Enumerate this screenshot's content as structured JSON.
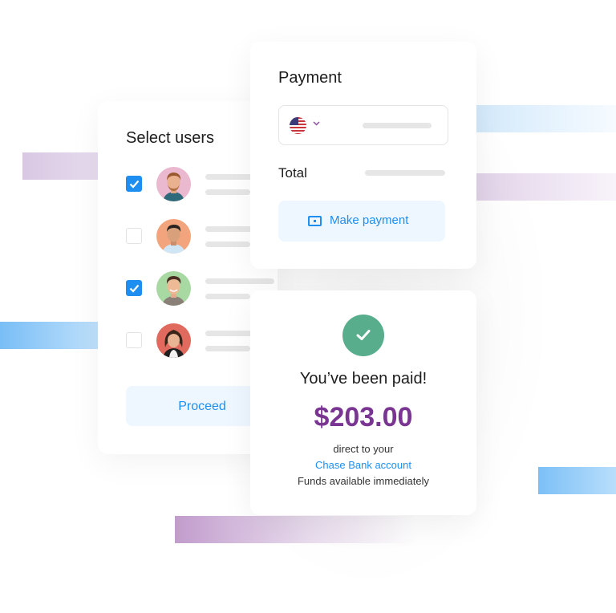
{
  "select_users": {
    "title": "Select users",
    "users": [
      {
        "checked": true,
        "avatar_bg": "#eab8cf",
        "avatar_icon": "man-red-beard-avatar"
      },
      {
        "checked": false,
        "avatar_bg": "#f2a57c",
        "avatar_icon": "man-dark-hair-avatar"
      },
      {
        "checked": true,
        "avatar_bg": "#a8d9a3",
        "avatar_icon": "man-smiling-avatar"
      },
      {
        "checked": false,
        "avatar_bg": "#e06a5e",
        "avatar_icon": "woman-curly-hair-avatar"
      }
    ],
    "proceed_label": "Proceed"
  },
  "payment": {
    "title": "Payment",
    "country_icon": "us-flag-icon",
    "total_label": "Total",
    "make_payment_label": "Make payment",
    "make_payment_icon": "cash-icon"
  },
  "paid": {
    "icon": "check-circle-icon",
    "title": "You’ve been paid!",
    "amount": "$203.00",
    "line1": "direct to your",
    "bank_link": "Chase Bank account",
    "line3": "Funds available immediately"
  },
  "colors": {
    "accent_blue": "#1e8ff0",
    "amount_purple": "#7a3592",
    "success_green": "#58ae8c",
    "button_bg": "#eef6ff"
  }
}
